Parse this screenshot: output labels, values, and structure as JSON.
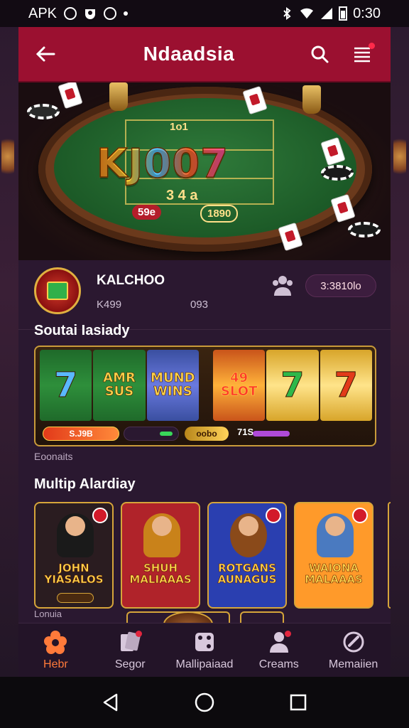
{
  "status_bar": {
    "left_text": "APK",
    "time": "0:30"
  },
  "header": {
    "title": "Ndaadsia"
  },
  "hero": {
    "logo_text": "KJ007",
    "felt_top": "1o1",
    "felt_mid": "3 4 a",
    "felt_bottom_left": "59e",
    "felt_bottom_right": "1890"
  },
  "profile": {
    "name": "KALCHOO",
    "stat_left": "K499",
    "stat_right": "093",
    "balance": "3:3810lo"
  },
  "sections": {
    "slots_title": "Soutai Iasiady",
    "slots_caption": "Eoonaits",
    "games_title": "Multip Alardiay",
    "peek_caption": "Lonuia"
  },
  "slot_panel": {
    "reels_left": [
      "7",
      "AMR SUS",
      "MUND WINS"
    ],
    "reels_right": [
      "49 SLOT",
      "7",
      "7"
    ],
    "bar_red": "S.J9B",
    "bar_gold": "oobo",
    "bar_purple_label": "71S"
  },
  "game_cards": [
    {
      "label": "JOHN YIASALOS",
      "bg": "#2a1c20",
      "person": "#1a1a1a"
    },
    {
      "label": "SHUH MALIAAAS",
      "bg": "#b0232a",
      "person": "#c9821a"
    },
    {
      "label": "ROTGANS AUNAGUS",
      "bg": "#2a3fb0",
      "person": "#8a4a1a"
    },
    {
      "label": "WAIONA MALAAAS",
      "bg": "#ff9a2a",
      "person": "#4a7ac0"
    }
  ],
  "bottom_nav": [
    {
      "label": "Hebr",
      "icon": "flower-icon",
      "active": true,
      "dot": false
    },
    {
      "label": "Segor",
      "icon": "cards-icon",
      "active": false,
      "dot": true
    },
    {
      "label": "Mallipaiaad",
      "icon": "dice-icon",
      "active": false,
      "dot": false
    },
    {
      "label": "Creams",
      "icon": "person-icon",
      "active": false,
      "dot": true
    },
    {
      "label": "Memaiien",
      "icon": "target-icon",
      "active": false,
      "dot": false
    }
  ],
  "colors": {
    "header": "#9b1030",
    "accent": "#ff7a3a",
    "gold": "#d6a53a"
  }
}
